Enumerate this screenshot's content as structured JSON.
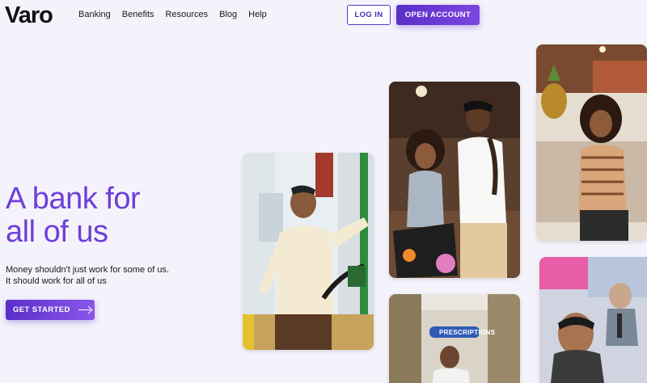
{
  "header": {
    "logo": "Varo",
    "nav": [
      "Banking",
      "Benefits",
      "Resources",
      "Blog",
      "Help"
    ],
    "login_label": "LOG IN",
    "open_account_label": "OPEN ACCOUNT"
  },
  "hero": {
    "title_line1": "A bank for",
    "title_line2": "all of us",
    "subtitle_line1": "Money shouldn't just work for some of us.",
    "subtitle_line2": "It should work for all of us",
    "cta_label": "GET STARTED"
  },
  "photos": {
    "gas_station_sign": "PRESCRIPTIONS"
  },
  "colors": {
    "brand_purple": "#6e3fd8",
    "button_purple": "#5a2fc7",
    "background": "#f4f3fb"
  },
  "icons": [
    "arrow-right-icon"
  ]
}
